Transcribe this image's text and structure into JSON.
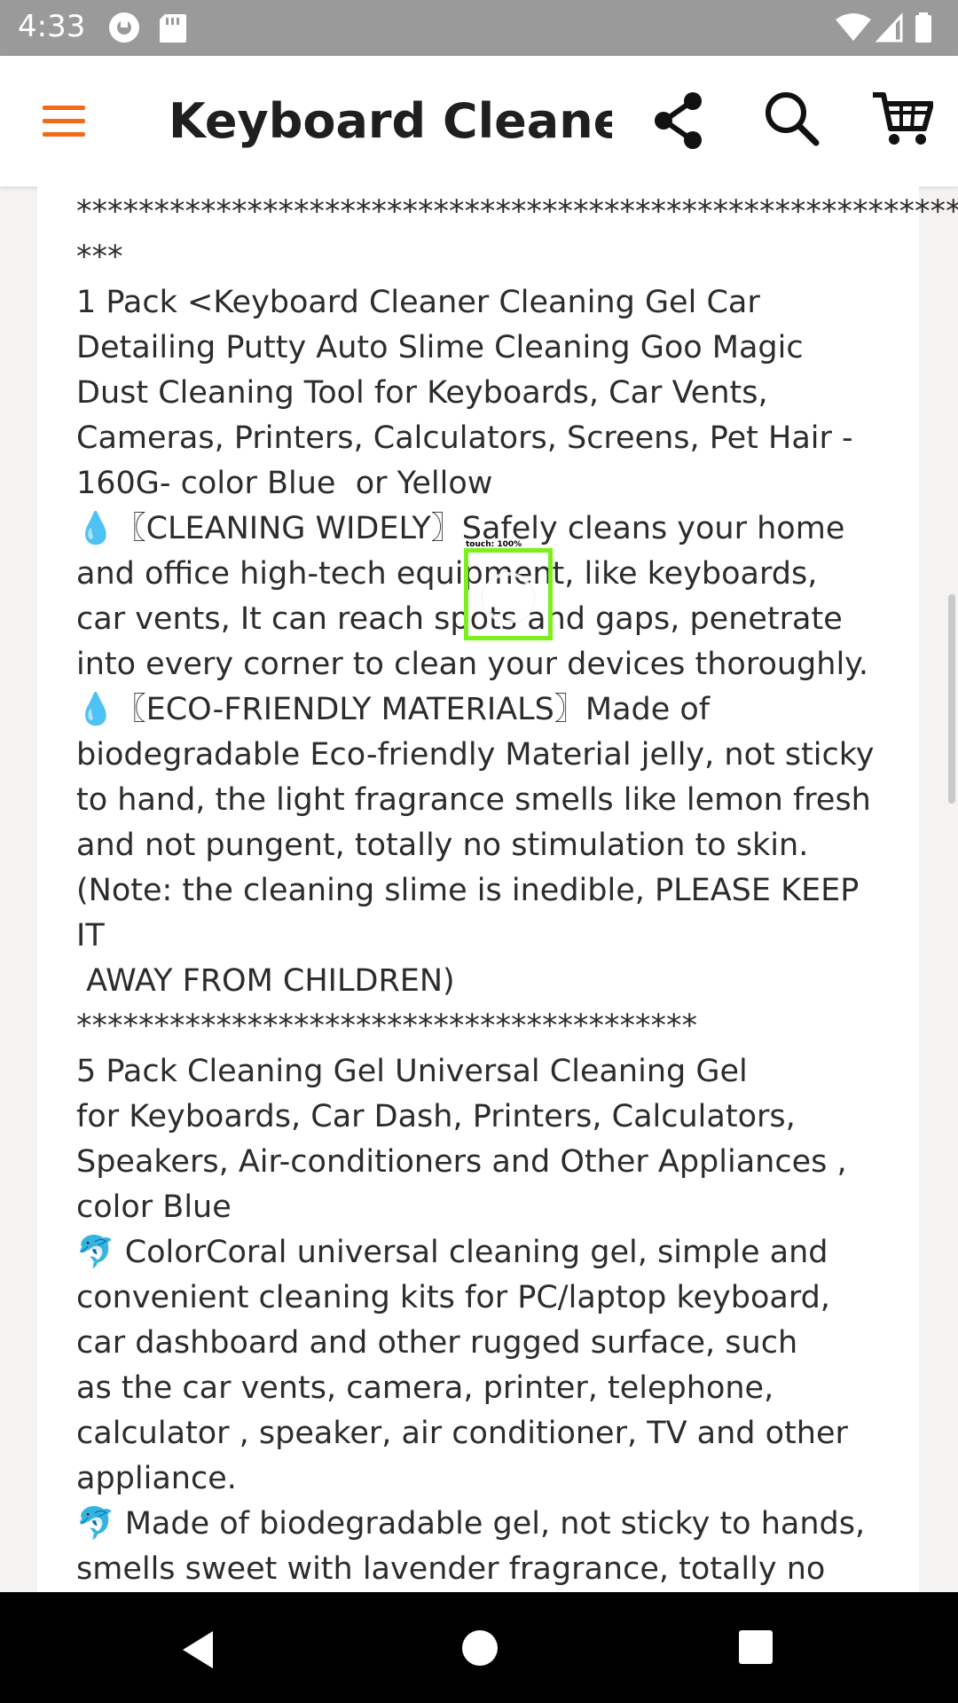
{
  "status_bar": {
    "time": "4:33",
    "left_icons": [
      "sync-icon",
      "sd-card-icon"
    ],
    "right_icons": [
      "wifi-icon",
      "cellular-signal-icon",
      "battery-icon"
    ]
  },
  "app_bar": {
    "title": "Keyboard Cleane…",
    "menu_icon": "hamburger-menu-icon",
    "share_icon": "share-icon",
    "search_icon": "search-icon",
    "cart_icon": "cart-icon",
    "accent_color": "#f26a1b"
  },
  "description": {
    "text": "**********************************************************\n***\n1 Pack <Keyboard Cleaner Cleaning Gel Car\nDetailing Putty Auto Slime Cleaning Goo Magic\nDust Cleaning Tool for Keyboards, Car Vents,\nCameras, Printers, Calculators, Screens, Pet Hair -\n160G- color Blue  or Yellow\n💧〖CLEANING WIDELY〗Safely cleans your home\nand office high-tech equipment, like keyboards,\ncar vents, It can reach spots and gaps, penetrate\ninto every corner to clean your devices thoroughly.\n💧〖ECO-FRIENDLY MATERIALS〗Made of\nbiodegradable Eco-friendly Material jelly, not sticky\nto hand, the light fragrance smells like lemon fresh\nand not pungent, totally no stimulation to skin.\n(Note: the cleaning slime is inedible, PLEASE KEEP\nIT\n AWAY FROM CHILDREN)\n****************************************\n5 Pack Cleaning Gel Universal Cleaning Gel\nfor Keyboards, Car Dash, Printers, Calculators,\nSpeakers, Air-conditioners and Other Appliances ,\ncolor Blue\n🐬 ColorCoral universal cleaning gel, simple and\nconvenient cleaning kits for PC/laptop keyboard,\ncar dashboard and other rugged surface, such\nas the car vents, camera, printer, telephone,\ncalculator , speaker, air conditioner, TV and other\nappliance.\n🐬 Made of biodegradable gel, not sticky to hands,\nsmells sweet with lavender fragrance, totally no"
  },
  "touch_indicator": {
    "label": "touch: 100%",
    "color": "#7cf01c"
  },
  "nav_bar": {
    "back_icon": "back-icon",
    "home_icon": "home-icon",
    "recents_icon": "recents-icon"
  }
}
